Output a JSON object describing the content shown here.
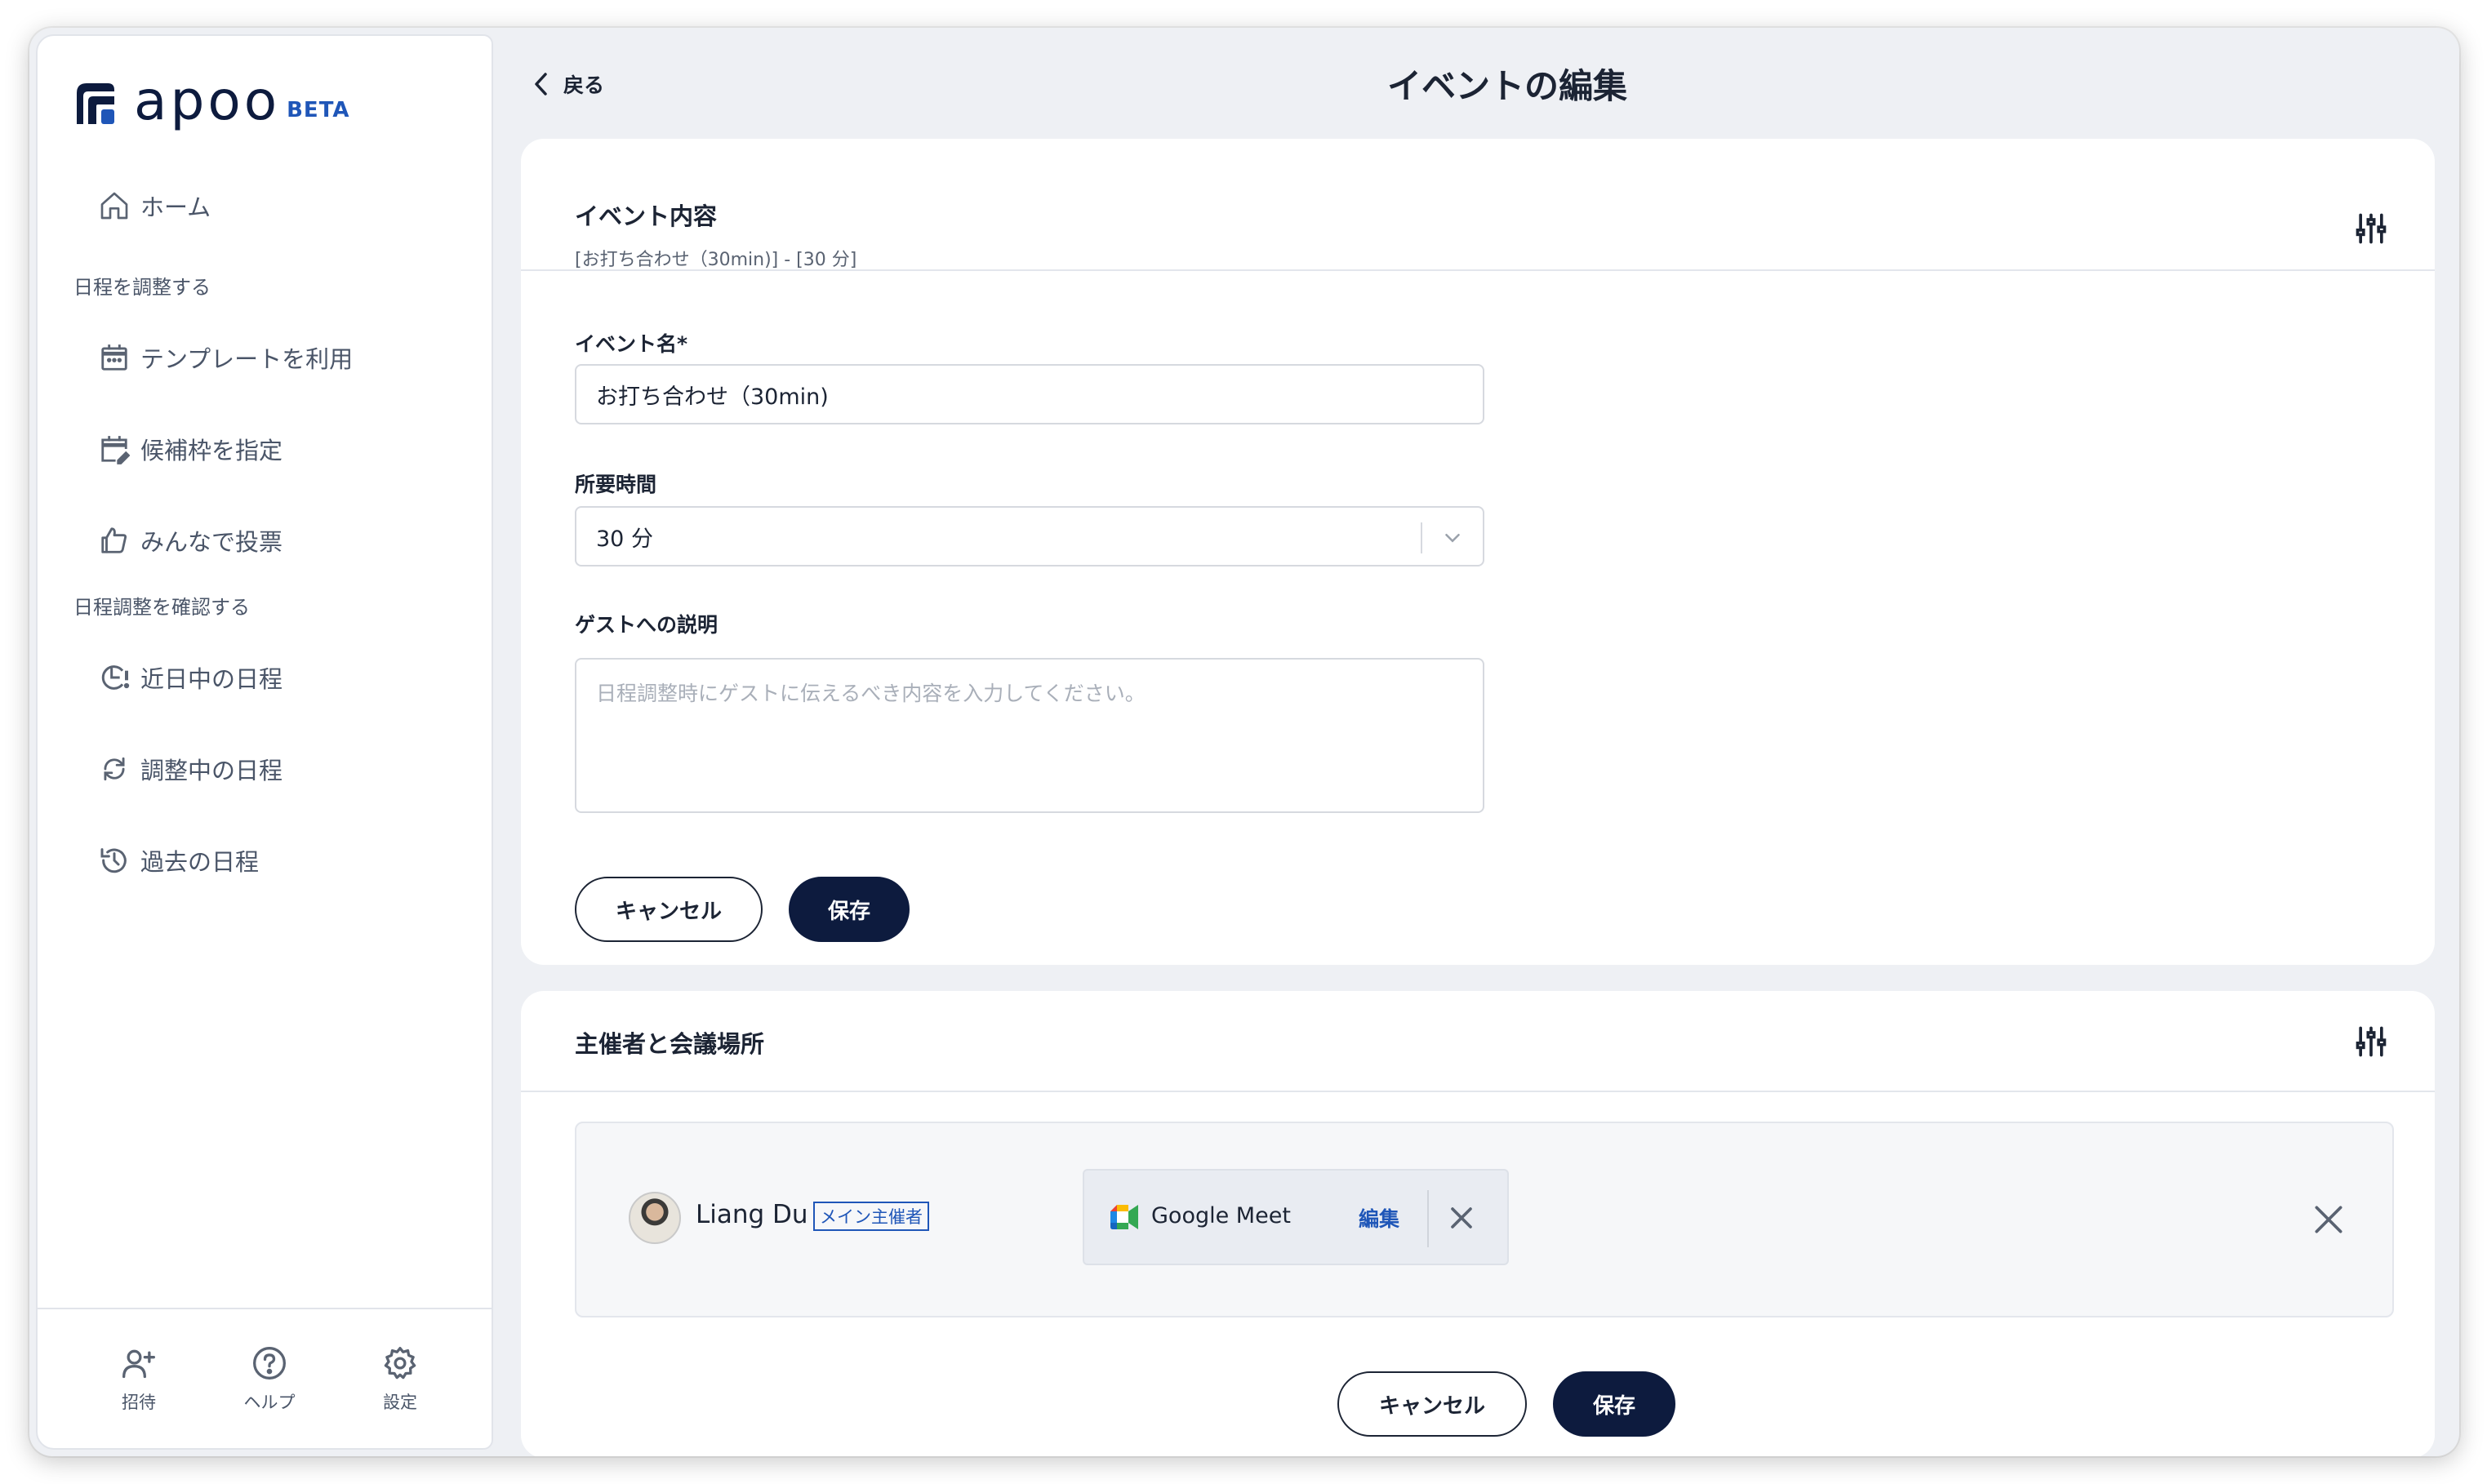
{
  "logo": {
    "text": "apoo",
    "badge": "BETA"
  },
  "sidebar": {
    "home": "ホーム",
    "section_schedule": "日程を調整する",
    "items_schedule": [
      {
        "label": "テンプレートを利用",
        "icon": "calendar-icon"
      },
      {
        "label": "候補枠を指定",
        "icon": "calendar-edit-icon"
      },
      {
        "label": "みんなで投票",
        "icon": "thumbs-up-icon"
      }
    ],
    "section_confirm": "日程調整を確認する",
    "items_confirm": [
      {
        "label": "近日中の日程",
        "icon": "clock-alert-icon"
      },
      {
        "label": "調整中の日程",
        "icon": "sync-icon"
      },
      {
        "label": "過去の日程",
        "icon": "history-icon"
      }
    ],
    "bottom": [
      {
        "label": "招待",
        "icon": "add-user-icon"
      },
      {
        "label": "ヘルプ",
        "icon": "help-icon"
      },
      {
        "label": "設定",
        "icon": "gear-icon"
      }
    ]
  },
  "header": {
    "back": "戻る",
    "title": "イベントの編集"
  },
  "event_card": {
    "title": "イベント内容",
    "subtitle": "[お打ち合わせ（30min)] - [30 分]",
    "name_label": "イベント名*",
    "name_value": "お打ち合わせ（30min)",
    "duration_label": "所要時間",
    "duration_value": "30 分",
    "desc_label": "ゲストへの説明",
    "desc_placeholder": "日程調整時にゲストに伝えるべき内容を入力してください。",
    "cancel": "キャンセル",
    "save": "保存"
  },
  "organizer_card": {
    "title": "主催者と会議場所",
    "organizer_name": "Liang Du",
    "organizer_badge": "メイン主催者",
    "location": "Google Meet",
    "edit": "編集",
    "cancel": "キャンセル",
    "save": "保存"
  },
  "colors": {
    "navy": "#0d1b3e",
    "accent_blue": "#1f56b8",
    "background": "#eef0f4"
  }
}
